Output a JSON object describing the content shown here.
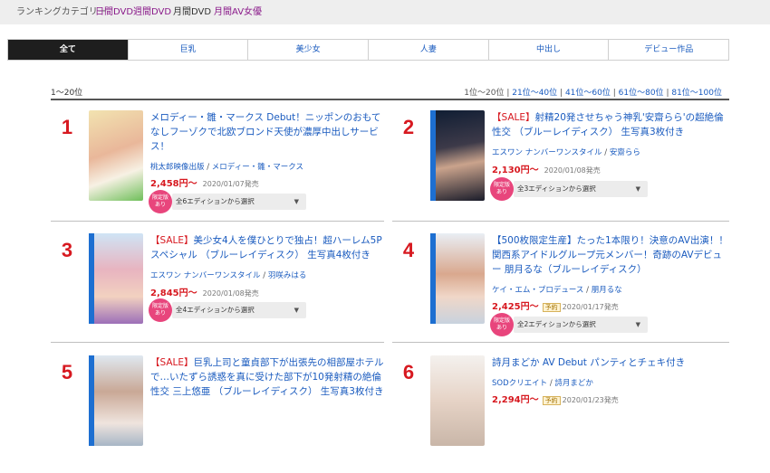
{
  "topbar": {
    "label": "ランキングカテゴリー",
    "links": [
      "日間DVD",
      "週間DVD",
      "月間DVD",
      "月間AV女優"
    ]
  },
  "tabs": [
    "全て",
    "巨乳",
    "美少女",
    "人妻",
    "中出し",
    "デビュー作品"
  ],
  "range": {
    "current": "1〜20位",
    "pages": [
      "1位〜20位",
      "21位〜40位",
      "41位〜60位",
      "61位〜80位",
      "81位〜100位"
    ],
    "sep": "|"
  },
  "items": [
    {
      "rank": "1",
      "sale": "",
      "title": "メロディー・雛・マークス Debut！ニッポンのおもてなしフーゾクで北欧ブロンド天使が濃厚中出しサービス！",
      "maker": "桃太郎映像出版",
      "actress": "メロディー・雛・マークス",
      "price": "2,458円〜",
      "date": "2020/01/07発売",
      "yoyaku": "",
      "badge": "限定版あり",
      "select": "全6エディションから選択"
    },
    {
      "rank": "2",
      "sale": "【SALE】",
      "title": "射精20発させちゃう神乳'安齋らら'の超絶倫性交 （ブルーレイディスク） 生写真3枚付き",
      "maker": "エスワン ナンバーワンスタイル",
      "actress": "安齋らら",
      "price": "2,130円〜",
      "date": "2020/01/08発売",
      "yoyaku": "",
      "badge": "限定版あり",
      "select": "全3エディションから選択"
    },
    {
      "rank": "3",
      "sale": "【SALE】",
      "title": "美少女4人を僕ひとりで独占！超ハーレム5Pスペシャル （ブルーレイディスク） 生写真4枚付き",
      "maker": "エスワン ナンバーワンスタイル",
      "actress": "羽咲みはる",
      "price": "2,845円〜",
      "date": "2020/01/08発売",
      "yoyaku": "",
      "badge": "限定版あり",
      "select": "全4エディションから選択"
    },
    {
      "rank": "4",
      "sale": "",
      "title": "【500枚限定生産】たった1本限り！決意のAV出演！！ 関西系アイドルグループ元メンバー！奇跡のAVデビュー 朋月るな（ブルーレイディスク）",
      "maker": "ケイ・エム・プロデュース",
      "actress": "朋月るな",
      "price": "2,425円〜",
      "date": "2020/01/17発売",
      "yoyaku": "予約",
      "badge": "限定版あり",
      "select": "全2エディションから選択"
    },
    {
      "rank": "5",
      "sale": "【SALE】",
      "title": "巨乳上司と童貞部下が出張先の相部屋ホテルで…いたずら誘惑を真に受けた部下が10発射精の絶倫性交 三上悠亜 （ブルーレイディスク） 生写真3枚付き",
      "maker": "",
      "actress": "",
      "price": "",
      "date": "",
      "yoyaku": "",
      "badge": "",
      "select": ""
    },
    {
      "rank": "6",
      "sale": "",
      "title": "詩月まどか AV Debut パンティとチェキ付き",
      "maker": "SODクリエイト",
      "actress": "詩月まどか",
      "price": "2,294円〜",
      "date": "2020/01/23発売",
      "yoyaku": "予約",
      "badge": "",
      "select": ""
    }
  ],
  "colors": {
    "accent": "#d71920",
    "link": "#1a5bbf",
    "badge": "#e8457c",
    "tab_active": "#1e1e1e"
  }
}
